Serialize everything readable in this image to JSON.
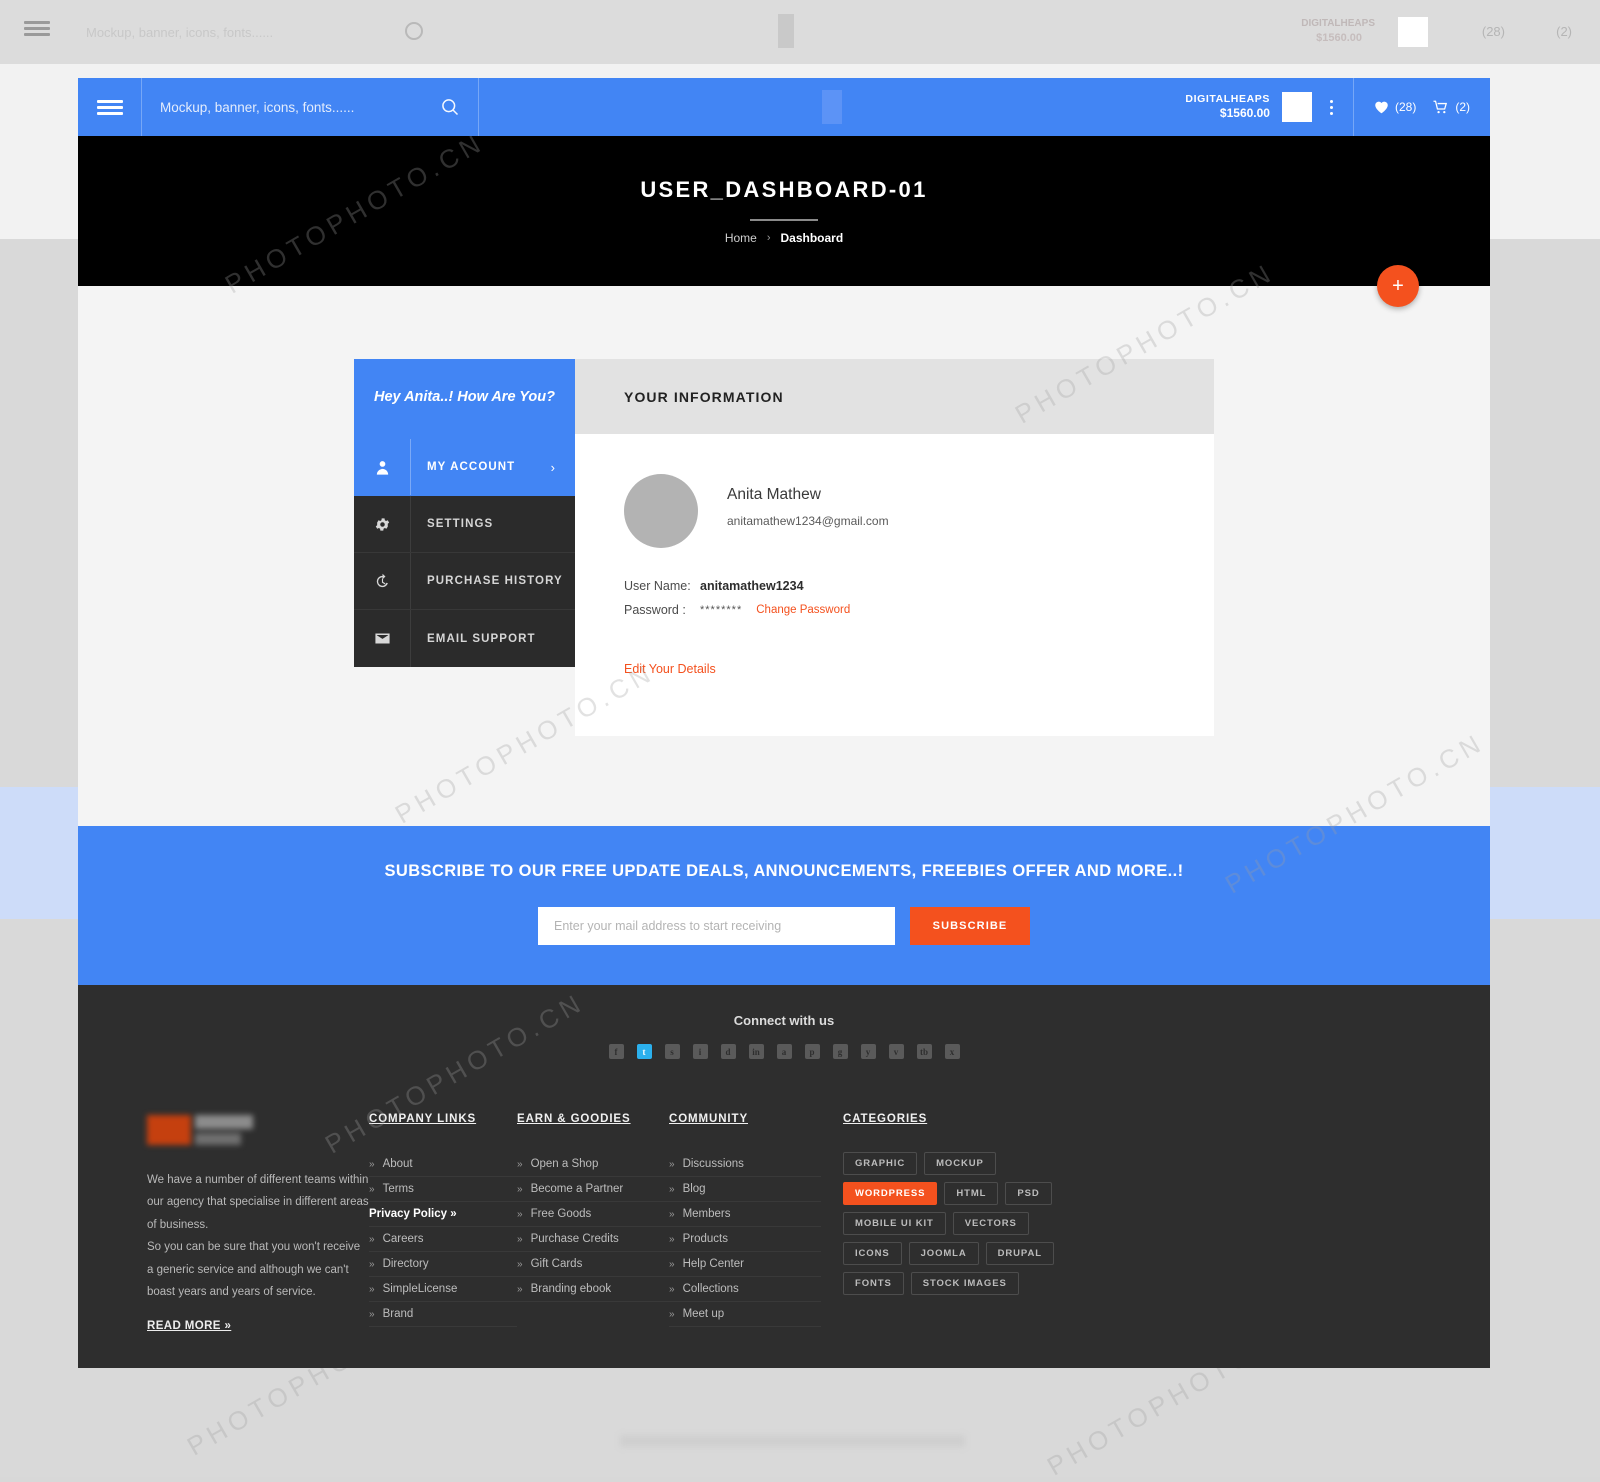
{
  "header": {
    "burger_label": "menu",
    "search_placeholder": "Mockup, banner, icons, fonts......",
    "account_name": "DIGITALHEAPS",
    "account_amount": "$1560.00",
    "wishlist_count": "(28)",
    "cart_count": "(2)"
  },
  "hero": {
    "title": "USER_DASHBOARD-01",
    "breadcrumb_home": "Home",
    "breadcrumb_sep": "›",
    "breadcrumb_current": "Dashboard",
    "fab_label": "+"
  },
  "sidebar": {
    "greeting": "Hey Anita..! How Are You?",
    "items": [
      {
        "label": "MY ACCOUNT",
        "icon": "user-icon",
        "active": true,
        "chevron": "›"
      },
      {
        "label": "SETTINGS",
        "icon": "gear-icon",
        "active": false
      },
      {
        "label": "PURCHASE HISTORY",
        "icon": "history-icon",
        "active": false
      },
      {
        "label": "EMAIL SUPPORT",
        "icon": "envelope-icon",
        "active": false
      }
    ]
  },
  "info_panel": {
    "title": "YOUR INFORMATION",
    "full_name": "Anita Mathew",
    "email": "anitamathew1234@gmail.com",
    "username_label": "User Name:",
    "username_value": "anitamathew1234",
    "password_label": "Password  :",
    "password_masked": "********",
    "change_password_link": "Change Password",
    "edit_details_link": "Edit Your Details"
  },
  "subscribe": {
    "heading": "SUBSCRIBE TO OUR FREE UPDATE DEALS, ANNOUNCEMENTS, FREEBIES OFFER AND MORE..!",
    "placeholder": "Enter your mail address to start receiving",
    "button": "SUBSCRIBE"
  },
  "footer": {
    "connect_title": "Connect with us",
    "socials": [
      {
        "name": "facebook-icon",
        "glyph": "f",
        "highlight": false
      },
      {
        "name": "twitter-icon",
        "glyph": "t",
        "highlight": true
      },
      {
        "name": "skype-icon",
        "glyph": "s",
        "highlight": false
      },
      {
        "name": "instagram-icon",
        "glyph": "i",
        "highlight": false
      },
      {
        "name": "dribbble-icon",
        "glyph": "d",
        "highlight": false
      },
      {
        "name": "linkedin-icon",
        "glyph": "in",
        "highlight": false
      },
      {
        "name": "apple-icon",
        "glyph": "a",
        "highlight": false
      },
      {
        "name": "pinterest-icon",
        "glyph": "p",
        "highlight": false
      },
      {
        "name": "google-plus-icon",
        "glyph": "g",
        "highlight": false
      },
      {
        "name": "youtube-icon",
        "glyph": "y",
        "highlight": false
      },
      {
        "name": "vimeo-icon",
        "glyph": "v",
        "highlight": false
      },
      {
        "name": "tumblr-icon",
        "glyph": "tb",
        "highlight": false
      },
      {
        "name": "xing-icon",
        "glyph": "x",
        "highlight": false
      }
    ],
    "about_text_1": "We have a number of different teams within our agency that specialise in different areas of business.",
    "about_text_2": "So you can be sure that you won't receive a generic service and although we can't boast years and years of service.",
    "read_more": "READ MORE »",
    "columns": [
      {
        "title": "COMPANY LINKS",
        "links": [
          {
            "label": "About",
            "bold": false
          },
          {
            "label": "Terms",
            "bold": false
          },
          {
            "label": "Privacy Policy  »",
            "bold": true
          },
          {
            "label": "Careers",
            "bold": false
          },
          {
            "label": "Directory",
            "bold": false
          },
          {
            "label": "SimpleLicense",
            "bold": false
          },
          {
            "label": "Brand",
            "bold": false
          }
        ]
      },
      {
        "title": "EARN & GOODIES",
        "links": [
          {
            "label": "Open a Shop",
            "bold": false
          },
          {
            "label": "Become a Partner",
            "bold": false
          },
          {
            "label": "Free Goods",
            "bold": false
          },
          {
            "label": "Purchase Credits",
            "bold": false
          },
          {
            "label": "Gift Cards",
            "bold": false
          },
          {
            "label": "Branding ebook",
            "bold": false
          }
        ]
      },
      {
        "title": "COMMUNITY",
        "links": [
          {
            "label": "Discussions",
            "bold": false
          },
          {
            "label": "Blog",
            "bold": false
          },
          {
            "label": "Members",
            "bold": false
          },
          {
            "label": "Products",
            "bold": false
          },
          {
            "label": "Help Center",
            "bold": false
          },
          {
            "label": "Collections",
            "bold": false
          },
          {
            "label": "Meet up",
            "bold": false
          }
        ]
      }
    ],
    "categories_title": "CATEGORIES",
    "categories": [
      {
        "label": "GRAPHIC",
        "selected": false
      },
      {
        "label": "MOCKUP",
        "selected": false
      },
      {
        "label": "WORDPRESS",
        "selected": true
      },
      {
        "label": "HTML",
        "selected": false
      },
      {
        "label": "PSD",
        "selected": false
      },
      {
        "label": "MOBILE UI KIT",
        "selected": false
      },
      {
        "label": "VECTORS",
        "selected": false
      },
      {
        "label": "ICONS",
        "selected": false
      },
      {
        "label": "JOOMLA",
        "selected": false
      },
      {
        "label": "DRUPAL",
        "selected": false
      },
      {
        "label": "FONTS",
        "selected": false
      },
      {
        "label": "STOCK IMAGES",
        "selected": false
      }
    ]
  },
  "colors": {
    "brand_blue": "#4285f4",
    "accent_orange": "#f4511e",
    "dark": "#2b2b2b",
    "hero_black": "#000000"
  },
  "watermark": {
    "text_1": "PHOTOPHOTO.CN",
    "text_2": "PHOTOPHOTO.CN"
  }
}
